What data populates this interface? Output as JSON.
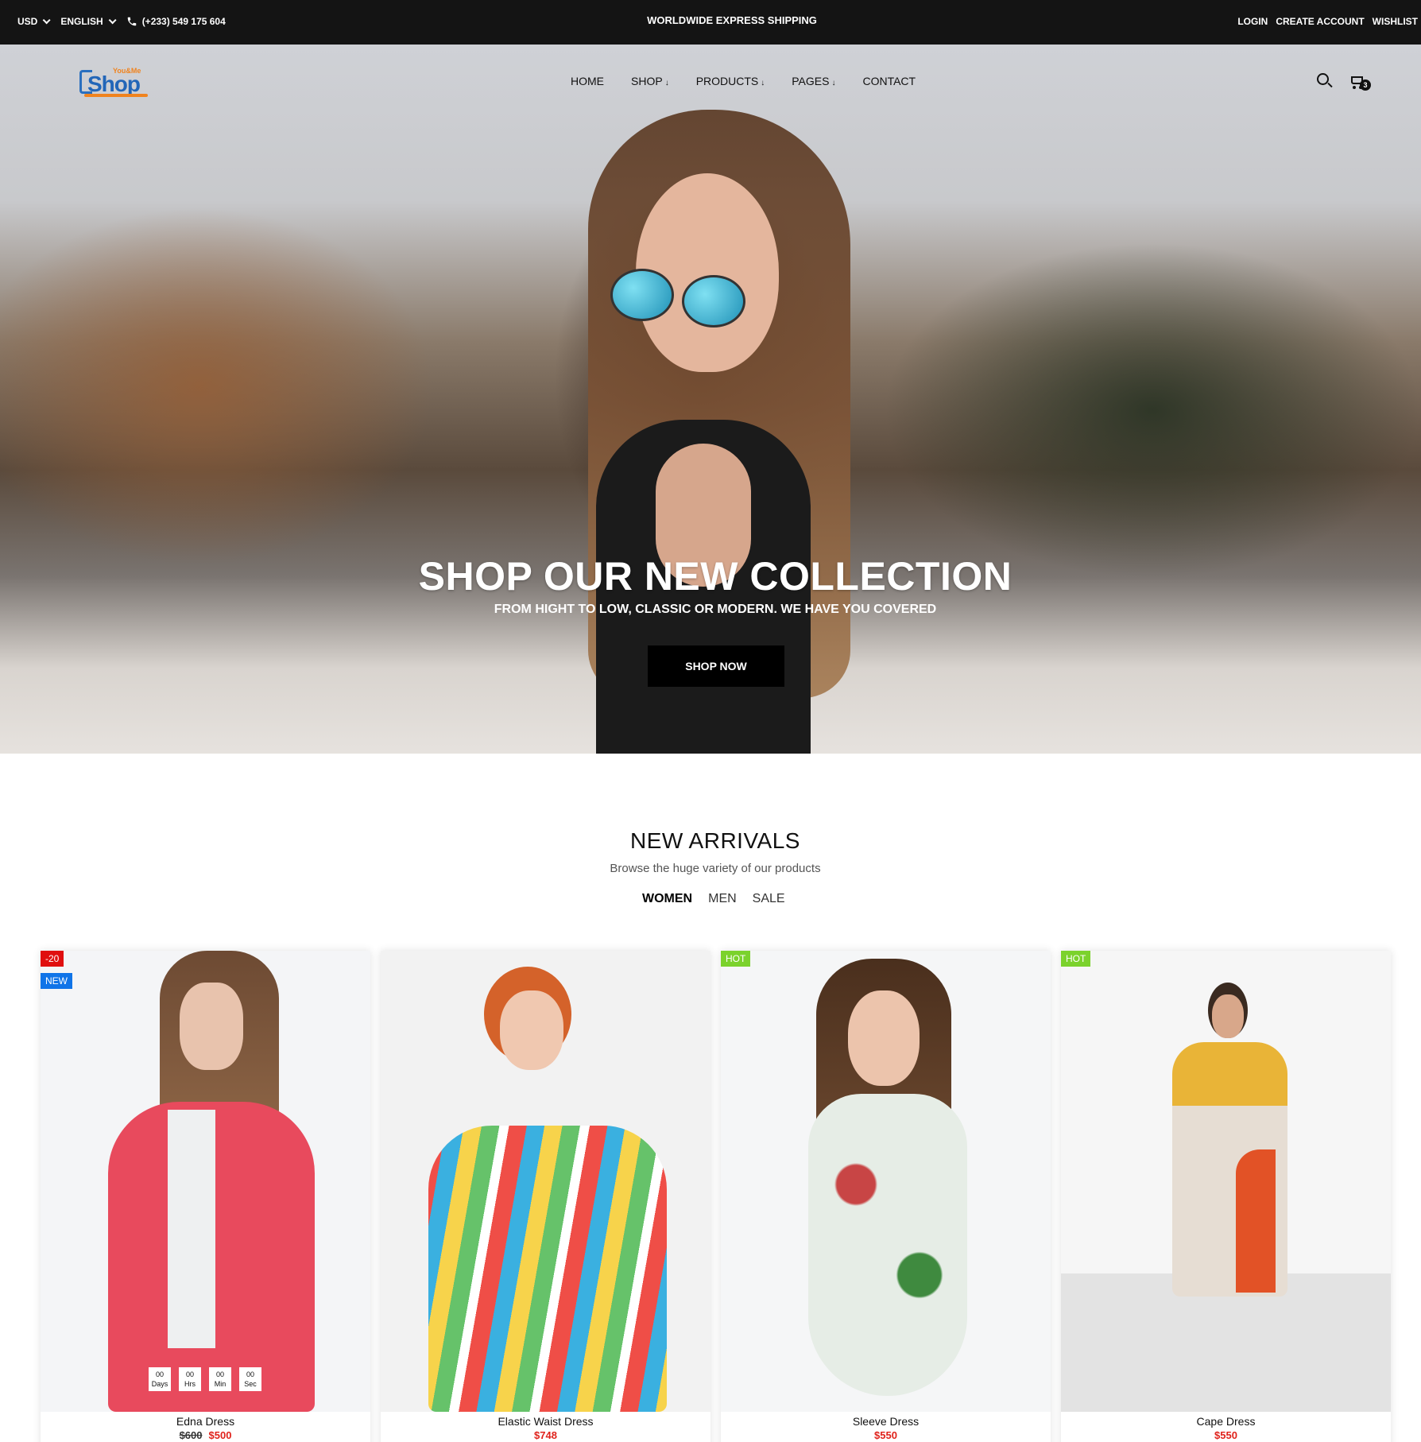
{
  "topbar": {
    "currency": "USD",
    "language": "ENGLISH",
    "phone": "(+233) 549 175 604",
    "promo": "WORLDWIDE EXPRESS SHIPPING",
    "links": [
      "LOGIN",
      "CREATE ACCOUNT",
      "WISHLIST"
    ]
  },
  "logo": {
    "small": "You&Me",
    "word": "Shop"
  },
  "nav": {
    "items": [
      {
        "label": "HOME",
        "dropdown": false
      },
      {
        "label": "SHOP",
        "dropdown": true
      },
      {
        "label": "PRODUCTS",
        "dropdown": true
      },
      {
        "label": "PAGES",
        "dropdown": true
      },
      {
        "label": "CONTACT",
        "dropdown": false
      }
    ],
    "cart_count": "3"
  },
  "hero": {
    "title": "SHOP OUR NEW COLLECTION",
    "subtitle": "FROM HIGHT TO LOW, CLASSIC OR MODERN. WE HAVE YOU COVERED",
    "cta": "SHOP NOW"
  },
  "arrivals": {
    "title": "NEW ARRIVALS",
    "subtitle": "Browse the huge variety of our products",
    "tabs": [
      "WOMEN",
      "MEN",
      "SALE"
    ],
    "active_tab": "WOMEN"
  },
  "products": [
    {
      "name": "Edna Dress",
      "old_price": "$600",
      "price": "$500",
      "badges": [
        "-20",
        "NEW"
      ],
      "countdown": [
        {
          "v": "00",
          "l": "Days"
        },
        {
          "v": "00",
          "l": "Hrs"
        },
        {
          "v": "00",
          "l": "Min"
        },
        {
          "v": "00",
          "l": "Sec"
        }
      ]
    },
    {
      "name": "Elastic Waist Dress",
      "price": "$748",
      "badges": []
    },
    {
      "name": "Sleeve Dress",
      "price": "$550",
      "badges": [
        "HOT"
      ]
    },
    {
      "name": "Cape Dress",
      "price": "$550",
      "badges": [
        "HOT"
      ]
    }
  ],
  "colors": {
    "topbar_bg": "#141414",
    "sale_badge": "#e00f0f",
    "new_badge": "#1074e8",
    "hot_badge": "#7bd22c",
    "price_red": "#e0221b"
  }
}
